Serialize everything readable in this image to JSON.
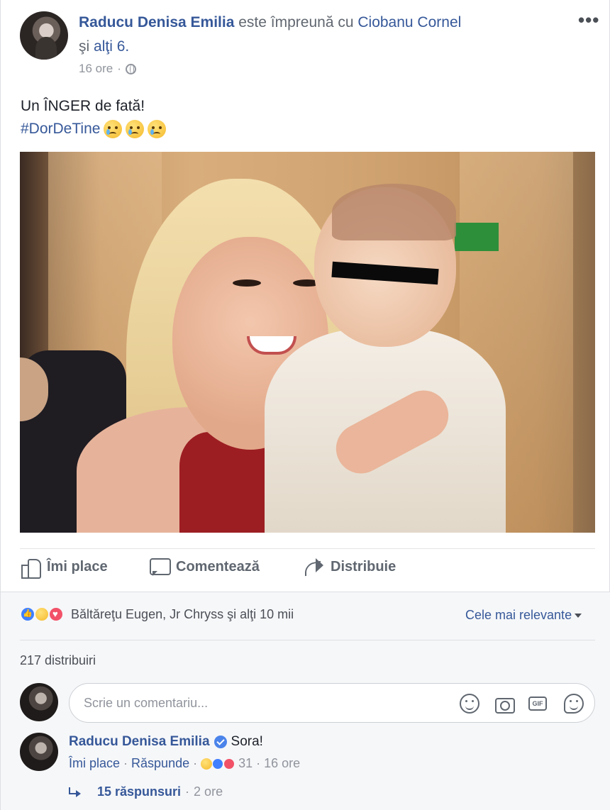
{
  "post": {
    "author": "Raducu Denisa Emilia",
    "with_text": "este împreună cu",
    "tagged": "Ciobanu Cornel",
    "and_text": "şi",
    "others": "alţi 6.",
    "time": "16 ore",
    "time_sep": "·",
    "privacy_icon": "globe-icon",
    "more_menu": "•••",
    "text_line1": "Un ÎNGER de fată!",
    "hashtag": "#DorDeTine",
    "emoji_icons": [
      "crying-face-icon",
      "crying-face-icon",
      "crying-face-icon"
    ]
  },
  "actions": {
    "like_label": "Îmi place",
    "comment_label": "Comentează",
    "share_label": "Distribuie"
  },
  "reactions": {
    "icons": [
      "like-reaction-icon",
      "sad-reaction-icon",
      "love-reaction-icon"
    ],
    "summary": "Băltăreţu Eugen, Jr Chryss şi alţi 10 mii",
    "sort_label": "Cele mai relevante",
    "shares": "217 distribuiri"
  },
  "composer": {
    "placeholder": "Scrie un comentariu..."
  },
  "comments": [
    {
      "author": "Raducu Denisa Emilia",
      "verified": true,
      "text": "Sora!",
      "like_label": "Îmi place",
      "sep": "·",
      "reply_label": "Răspunde",
      "reaction_count": "31",
      "time": "16 ore",
      "replies_label": "15 răspunsuri",
      "replies_time": "2 ore"
    }
  ],
  "colors": {
    "link": "#365899",
    "muted": "#90949c",
    "like_blue": "#4080ff",
    "love_red": "#f25268"
  }
}
